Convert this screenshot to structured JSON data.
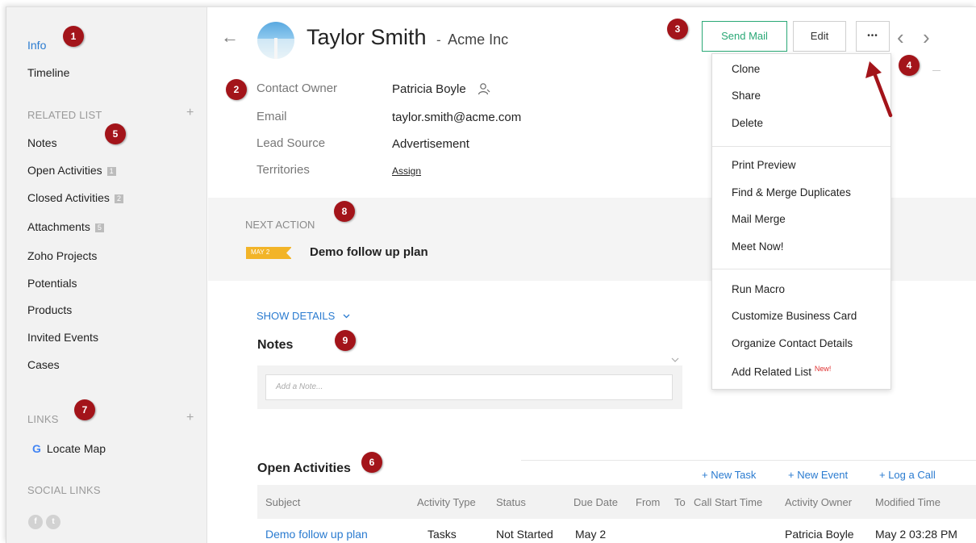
{
  "sidebar": {
    "info": "Info",
    "timeline": "Timeline",
    "related_list_header": "RELATED LIST",
    "plus": "+",
    "related_items": [
      {
        "label": "Notes",
        "count": ""
      },
      {
        "label": "Open Activities",
        "count": "1"
      },
      {
        "label": "Closed Activities",
        "count": "2"
      },
      {
        "label": "Attachments",
        "count": "5"
      },
      {
        "label": "Zoho Projects",
        "count": ""
      },
      {
        "label": "Potentials",
        "count": ""
      },
      {
        "label": "Products",
        "count": ""
      },
      {
        "label": "Invited Events",
        "count": ""
      },
      {
        "label": "Cases",
        "count": ""
      }
    ],
    "links_header": "LINKS",
    "locate_map_icon": "G",
    "locate_map": "Locate Map",
    "social_links_header": "SOCIAL LINKS",
    "social_icons": [
      "facebook-icon",
      "twitter-icon"
    ]
  },
  "header": {
    "back_icon": "←",
    "name": "Taylor Smith",
    "separator": "-",
    "company": "Acme Inc",
    "send_mail": "Send Mail",
    "edit": "Edit",
    "more": "•••",
    "prev": "‹",
    "next": "›"
  },
  "details": {
    "owner_label": "Contact Owner",
    "owner_value": "Patricia Boyle",
    "email_label": "Email",
    "email_value": "taylor.smith@acme.com",
    "lead_label": "Lead Source",
    "lead_value": "Advertisement",
    "territories_label": "Territories",
    "territories_value": "Assign"
  },
  "next_action": {
    "header": "NEXT ACTION",
    "date_tag": "MAY 2",
    "title": "Demo follow up plan"
  },
  "notes": {
    "show_details": "SHOW DETAILS",
    "title": "Notes",
    "placeholder": "Add a Note..."
  },
  "open_activities": {
    "title": "Open Activities",
    "new_task": "+ New Task",
    "new_event": "+ New Event",
    "log_call": "+ Log a Call",
    "columns": [
      "Subject",
      "Activity Type",
      "Status",
      "Due Date",
      "From",
      "To",
      "Call Start Time",
      "Activity Owner",
      "Modified Time"
    ],
    "rows": [
      {
        "subject": "Demo follow up plan",
        "type": "Tasks",
        "status": "Not Started",
        "due": "May 2",
        "owner": "Patricia Boyle",
        "modified": "May 2 03:28 PM"
      }
    ]
  },
  "more_menu": {
    "group1": [
      "Clone",
      "Share",
      "Delete"
    ],
    "group2": [
      "Print Preview",
      "Find & Merge Duplicates",
      "Mail Merge",
      "Meet Now!"
    ],
    "group3": [
      "Run Macro",
      "Customize Business Card",
      "Organize Contact Details"
    ],
    "add_related": "Add Related List",
    "new_tag": "New!"
  },
  "badges": [
    "1",
    "2",
    "3",
    "4",
    "5",
    "6",
    "7",
    "8",
    "9"
  ],
  "colors": {
    "accent_blue": "#2a7bd0",
    "send_mail_green": "#2aa876",
    "badge_red": "#a3141a",
    "date_tag_yellow": "#f2b428",
    "new_tag_red": "#e03030"
  }
}
